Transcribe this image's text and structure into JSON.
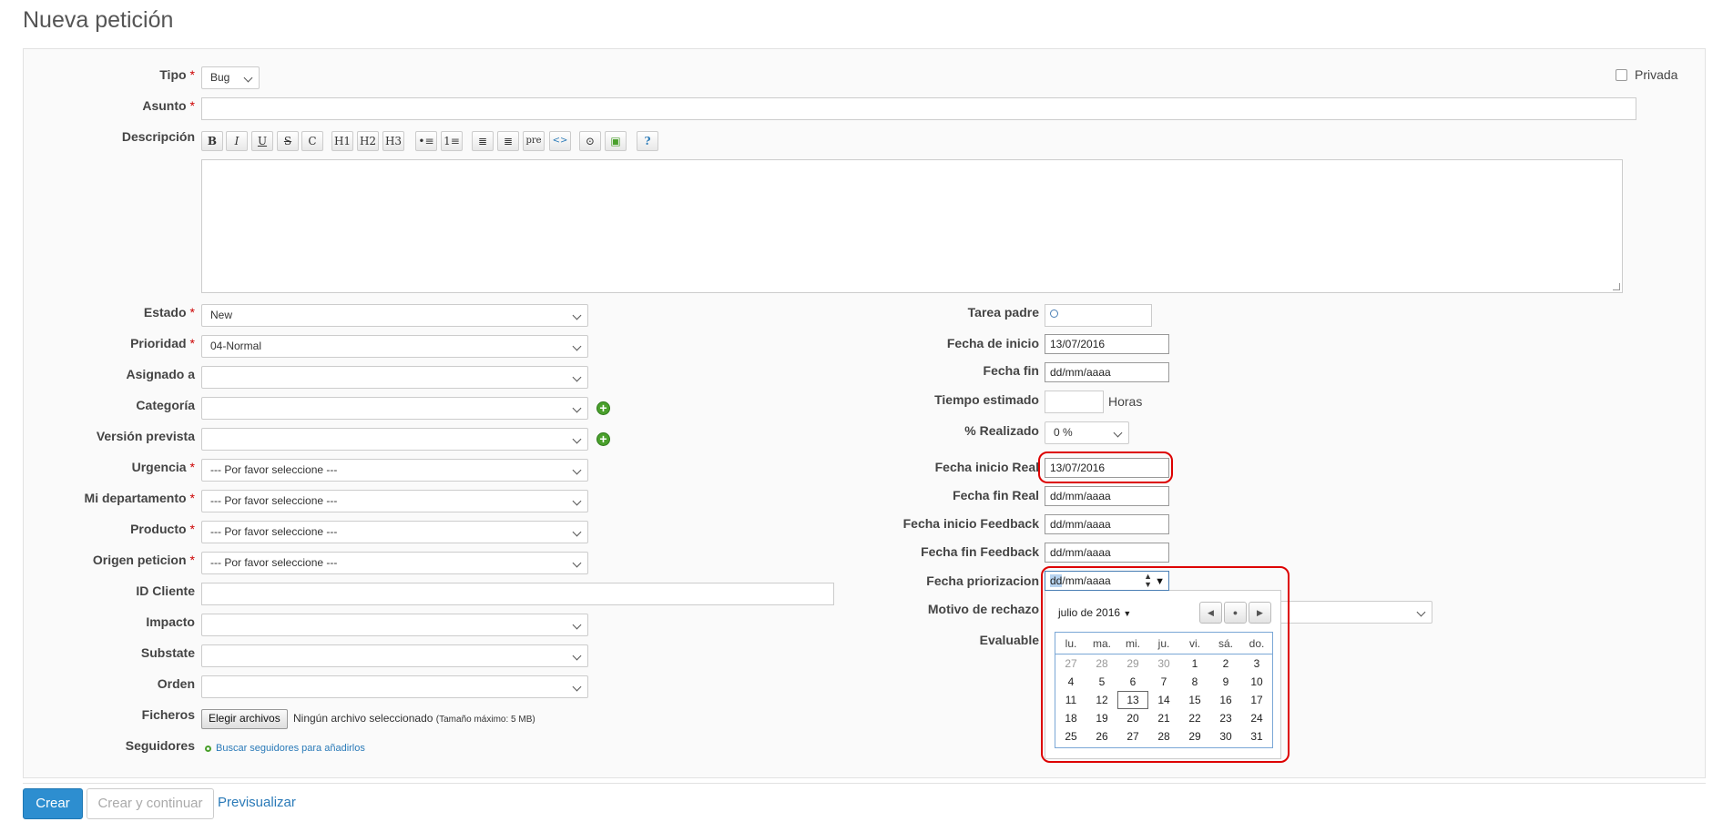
{
  "page": {
    "title": "Nueva petición"
  },
  "header": {
    "tipo": {
      "label": "Tipo",
      "value": "Bug"
    },
    "privada": {
      "label": "Privada"
    },
    "asunto": {
      "label": "Asunto",
      "value": ""
    },
    "descripcion": {
      "label": "Descripción",
      "toolbar": [
        {
          "name": "bold-button",
          "glyph": "B"
        },
        {
          "name": "italic-button",
          "glyph": "I"
        },
        {
          "name": "underline-button",
          "glyph": "U"
        },
        {
          "name": "strikethrough-button",
          "glyph": "S"
        },
        {
          "name": "code-inline-button",
          "glyph": "C"
        },
        {
          "name": "heading1-button",
          "glyph": "H1"
        },
        {
          "name": "heading2-button",
          "glyph": "H2"
        },
        {
          "name": "heading3-button",
          "glyph": "H3"
        },
        {
          "name": "unordered-list-button",
          "glyph": "•≡"
        },
        {
          "name": "ordered-list-button",
          "glyph": "1≡"
        },
        {
          "name": "indent-button",
          "glyph": "≣"
        },
        {
          "name": "outdent-button",
          "glyph": "≣"
        },
        {
          "name": "pre-button",
          "glyph": "pre"
        },
        {
          "name": "code-button",
          "glyph": "<>"
        },
        {
          "name": "link-button",
          "glyph": "⊙"
        },
        {
          "name": "image-button",
          "glyph": "▣"
        },
        {
          "name": "help-button",
          "glyph": "?"
        }
      ]
    }
  },
  "left": {
    "estado": {
      "label": "Estado",
      "value": "New"
    },
    "prioridad": {
      "label": "Prioridad",
      "value": "04-Normal"
    },
    "asignado": {
      "label": "Asignado a",
      "value": ""
    },
    "categoria": {
      "label": "Categoría",
      "value": ""
    },
    "version": {
      "label": "Versión prevista",
      "value": ""
    },
    "urgencia": {
      "label": "Urgencia",
      "value": "--- Por favor seleccione ---"
    },
    "departamento": {
      "label": "Mi departamento",
      "value": "--- Por favor seleccione ---"
    },
    "producto": {
      "label": "Producto",
      "value": "--- Por favor seleccione ---"
    },
    "origen": {
      "label": "Origen peticion",
      "value": "--- Por favor seleccione ---"
    },
    "id_cliente": {
      "label": "ID Cliente",
      "value": ""
    },
    "impacto": {
      "label": "Impacto",
      "value": ""
    },
    "substate": {
      "label": "Substate",
      "value": ""
    },
    "orden": {
      "label": "Orden",
      "value": ""
    },
    "ficheros": {
      "label": "Ficheros",
      "button": "Elegir archivos",
      "status": "Ningún archivo seleccionado",
      "note": "(Tamaño máximo: 5 MB)"
    },
    "seguidores": {
      "label": "Seguidores",
      "link": "Buscar seguidores para añadirlos"
    }
  },
  "right": {
    "tarea_padre": {
      "label": "Tarea padre",
      "value": ""
    },
    "fecha_inicio": {
      "label": "Fecha de inicio",
      "value": "13/07/2016"
    },
    "fecha_fin": {
      "label": "Fecha fin",
      "value": "dd/mm/aaaa"
    },
    "tiempo_estimado": {
      "label": "Tiempo estimado",
      "value": "",
      "unit": "Horas"
    },
    "realizado": {
      "label": "% Realizado",
      "value": "0 %"
    },
    "fecha_inicio_real": {
      "label": "Fecha inicio Real",
      "value": "13/07/2016"
    },
    "fecha_fin_real": {
      "label": "Fecha fin Real",
      "value": "dd/mm/aaaa"
    },
    "fecha_inicio_feedback": {
      "label": "Fecha inicio Feedback",
      "value": "dd/mm/aaaa"
    },
    "fecha_fin_feedback": {
      "label": "Fecha fin Feedback",
      "value": "dd/mm/aaaa"
    },
    "fecha_priorizacion": {
      "label": "Fecha priorizacion",
      "value_selected": "dd",
      "value_rest": "/mm/aaaa"
    },
    "motivo_rechazo": {
      "label": "Motivo de rechazo",
      "value": ""
    },
    "evaluable": {
      "label": "Evaluable"
    }
  },
  "calendar": {
    "month_label": "julio de 2016",
    "weekdays": [
      "lu.",
      "ma.",
      "mi.",
      "ju.",
      "vi.",
      "sá.",
      "do."
    ],
    "weeks": [
      [
        "27",
        "28",
        "29",
        "30",
        "1",
        "2",
        "3"
      ],
      [
        "4",
        "5",
        "6",
        "7",
        "8",
        "9",
        "10"
      ],
      [
        "11",
        "12",
        "13",
        "14",
        "15",
        "16",
        "17"
      ],
      [
        "18",
        "19",
        "20",
        "21",
        "22",
        "23",
        "24"
      ],
      [
        "25",
        "26",
        "27",
        "28",
        "29",
        "30",
        "31"
      ]
    ],
    "today": "13"
  },
  "actions": {
    "crear": "Crear",
    "crear_continuar": "Crear y continuar",
    "previsualizar": "Previsualizar"
  },
  "colors": {
    "primary": "#2d8ed0",
    "required": "#cc0000",
    "highlight": "#dd0000",
    "link": "#2a7ab8"
  }
}
